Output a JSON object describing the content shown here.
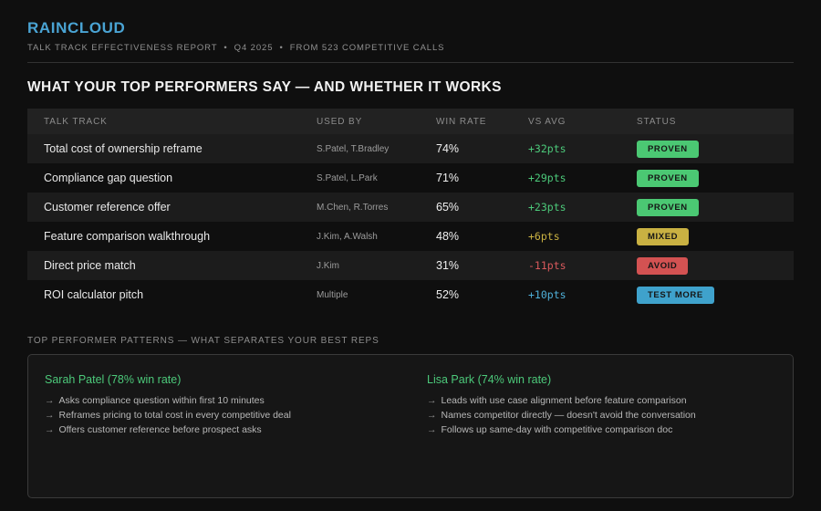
{
  "brand": {
    "name": "RAINCLOUD",
    "subtitle": "TALK TRACK EFFECTIVENESS REPORT  •  Q4 2025  •  FROM 523 COMPETITIVE CALLS"
  },
  "page_title": "WHAT YOUR TOP PERFORMERS SAY — AND WHETHER IT WORKS",
  "colors": {
    "brand_blue": "#4aa4d4",
    "positive_green": "#4cc97a",
    "mixed_gold": "#c9b142",
    "negative_red": "#d9595c",
    "test_blue": "#4fb0d9"
  },
  "table": {
    "columns": [
      "TALK TRACK",
      "USED BY",
      "WIN RATE",
      "VS AVG",
      "STATUS"
    ],
    "rows": [
      {
        "talk_track": "Total cost of ownership reframe",
        "used_by": "S.Patel, T.Bradley",
        "win_rate": "74%",
        "vs_avg": "+32pts",
        "vs_avg_color": "#4cc97a",
        "status": "PROVEN",
        "status_color": "#4bc873"
      },
      {
        "talk_track": "Compliance gap question",
        "used_by": "S.Patel, L.Park",
        "win_rate": "71%",
        "vs_avg": "+29pts",
        "vs_avg_color": "#4cc97a",
        "status": "PROVEN",
        "status_color": "#4bc873"
      },
      {
        "talk_track": "Customer reference offer",
        "used_by": "M.Chen, R.Torres",
        "win_rate": "65%",
        "vs_avg": "+23pts",
        "vs_avg_color": "#4cc97a",
        "status": "PROVEN",
        "status_color": "#4bc873"
      },
      {
        "talk_track": "Feature comparison walkthrough",
        "used_by": "J.Kim, A.Walsh",
        "win_rate": "48%",
        "vs_avg": "+6pts",
        "vs_avg_color": "#c9b142",
        "status": "MIXED",
        "status_color": "#c9b142"
      },
      {
        "talk_track": "Direct price match",
        "used_by": "J.Kim",
        "win_rate": "31%",
        "vs_avg": "-11pts",
        "vs_avg_color": "#d9595c",
        "status": "AVOID",
        "status_color": "#d35252"
      },
      {
        "talk_track": "ROI calculator pitch",
        "used_by": "Multiple",
        "win_rate": "52%",
        "vs_avg": "+10pts",
        "vs_avg_color": "#4fb0d9",
        "status": "TEST MORE",
        "status_color": "#3fa2cc"
      }
    ]
  },
  "patterns": {
    "label": "TOP PERFORMER PATTERNS — WHAT SEPARATES YOUR BEST REPS",
    "arrow": "→",
    "performers": [
      {
        "name": "Sarah Patel (78% win rate)",
        "items": [
          "Asks compliance question within first 10 minutes",
          "Reframes pricing to total cost in every competitive deal",
          "Offers customer reference before prospect asks"
        ]
      },
      {
        "name": "Lisa Park (74% win rate)",
        "items": [
          "Leads with use case alignment before feature comparison",
          "Names competitor directly — doesn't avoid the conversation",
          "Follows up same-day with competitive comparison doc"
        ]
      }
    ]
  }
}
